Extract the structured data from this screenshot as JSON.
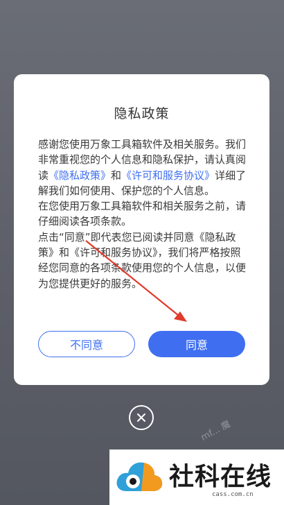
{
  "dialog": {
    "title": "隐私政策",
    "para1_a": "感谢您使用万象工具箱软件及相关服务。我们非常重视您的个人信息和隐私保护，请认真阅读",
    "link_privacy": "《隐私政策》",
    "para1_b": "和",
    "link_license": "《许可和服务协议》",
    "para1_c": "详细了解我们如何使用、保护您的个人信息。",
    "para2": "在您使用万象工具箱软件和相关服务之前，请仔细阅读各项条款。",
    "para3": "点击“同意”即代表您已阅读并同意《隐私政策》和《许可和服务协议》，我们将严格按照经您同意的各项条款使用您的个人信息，以便为您提供更好的服务。",
    "decline_label": "不同意",
    "agree_label": "同意"
  },
  "close_icon": "close-x-circle",
  "watermark": {
    "diagonal": "mf... 魔",
    "brand": "社科在线",
    "domain": "cass.com.cn"
  },
  "colors": {
    "accent": "#3f6ff0",
    "overlay": "#5c5f68",
    "arrow": "#e23a2b"
  }
}
